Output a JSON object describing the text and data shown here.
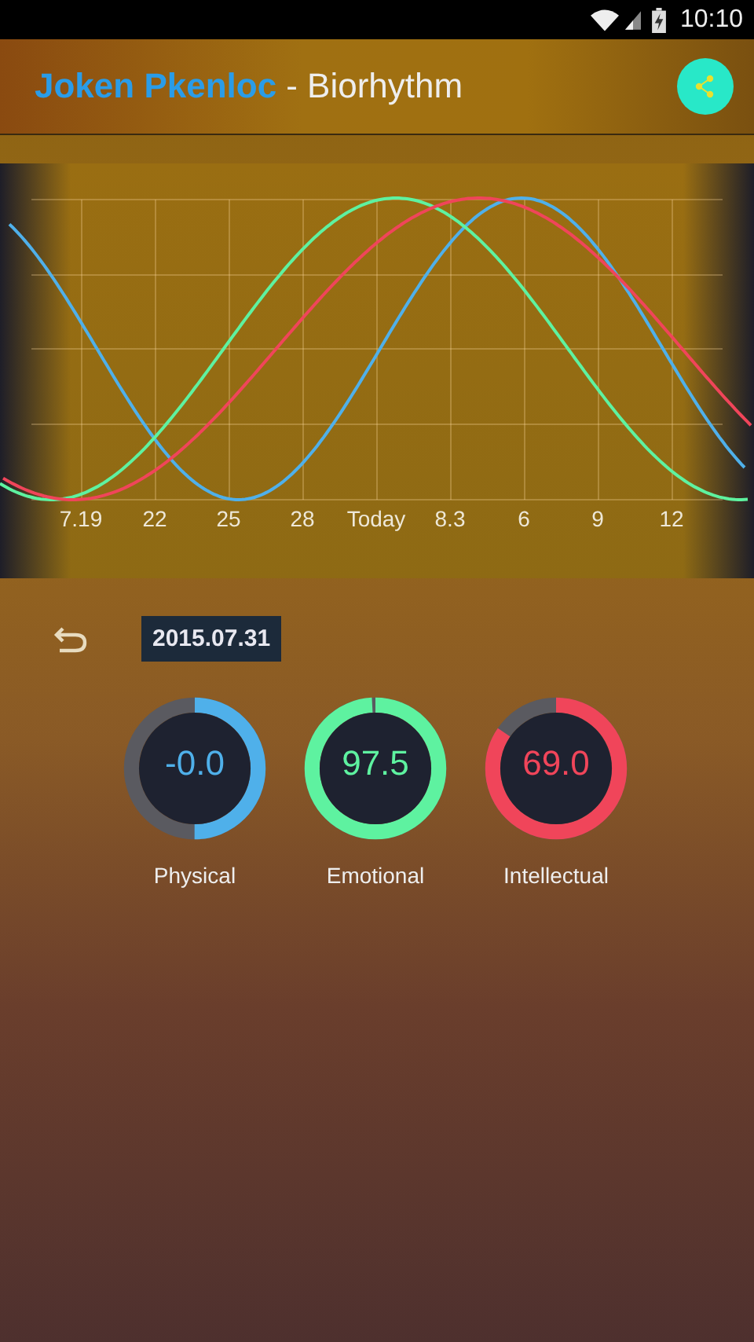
{
  "status_bar": {
    "time": "10:10"
  },
  "header": {
    "name": "Joken Pkenloc",
    "title": "- Biorhythm"
  },
  "chart": {
    "x_labels": [
      "7.19",
      "22",
      "25",
      "28",
      "Today",
      "8.3",
      "6",
      "9",
      "12"
    ]
  },
  "date": "2015.07.31",
  "gauges": [
    {
      "label": "Physical",
      "value": "-0.0",
      "level": 0.5,
      "color": "#4fb0ea"
    },
    {
      "label": "Emotional",
      "value": "97.5",
      "level": 0.99,
      "color": "#5ef2a0"
    },
    {
      "label": "Intellectual",
      "value": "69.0",
      "level": 0.845,
      "color": "#f0455a"
    }
  ]
}
